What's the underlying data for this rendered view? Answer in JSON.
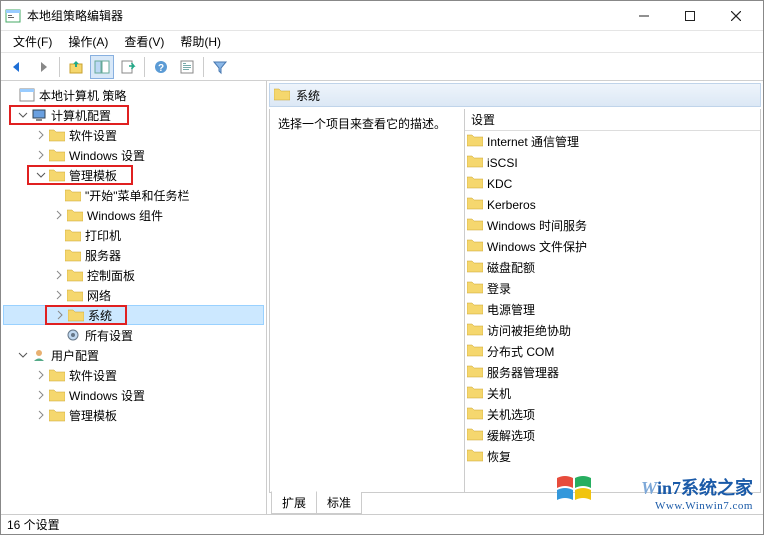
{
  "window": {
    "title": "本地组策略编辑器"
  },
  "menu": {
    "file": "文件(F)",
    "action": "操作(A)",
    "view": "查看(V)",
    "help": "帮助(H)"
  },
  "tree": {
    "root": "本地计算机 策略",
    "computer_config": "计算机配置",
    "software_settings": "软件设置",
    "windows_settings": "Windows 设置",
    "admin_templates": "管理模板",
    "start_menu": "\"开始\"菜单和任务栏",
    "windows_components": "Windows 组件",
    "printers": "打印机",
    "servers": "服务器",
    "control_panel": "控制面板",
    "network": "网络",
    "system": "系统",
    "all_settings": "所有设置",
    "user_config": "用户配置",
    "u_software": "软件设置",
    "u_windows": "Windows 设置",
    "u_admin": "管理模板"
  },
  "right": {
    "header": "系统",
    "desc": "选择一个项目来查看它的描述。",
    "col_setting": "设置",
    "items": [
      "Internet 通信管理",
      "iSCSI",
      "KDC",
      "Kerberos",
      "Windows 时间服务",
      "Windows 文件保护",
      "磁盘配额",
      "登录",
      "电源管理",
      "访问被拒绝协助",
      "分布式 COM",
      "服务器管理器",
      "关机",
      "关机选项",
      "缓解选项",
      "恢复"
    ]
  },
  "tabs": {
    "extended": "扩展",
    "standard": "标准"
  },
  "status": "16 个设置",
  "watermark": {
    "line1a": "W",
    "line1b": "in7系统之家",
    "line2": "Www.Winwin7.com"
  }
}
